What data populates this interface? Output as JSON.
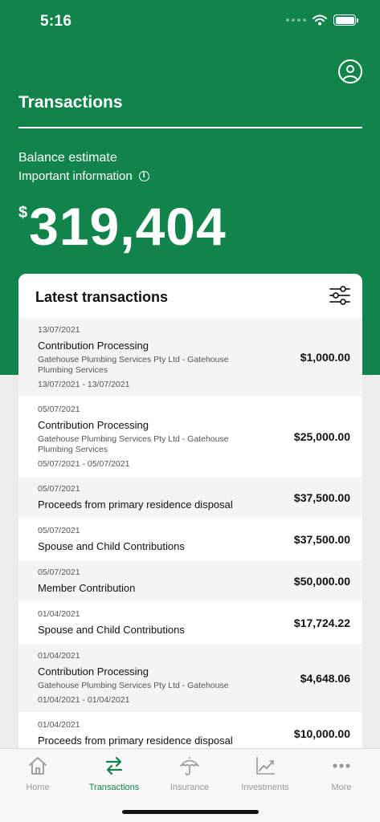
{
  "status_bar": {
    "time": "5:16"
  },
  "header": {
    "title": "Transactions",
    "balance_label": "Balance estimate",
    "info_label": "Important information",
    "currency_symbol": "$",
    "balance_amount": "319,404"
  },
  "card": {
    "title": "Latest transactions"
  },
  "transactions": [
    {
      "date": "13/07/2021",
      "title": "Contribution Processing",
      "description": "Gatehouse Plumbing Services Pty Ltd - Gatehouse Plumbing Services",
      "range": "13/07/2021 - 13/07/2021",
      "amount": "$1,000.00"
    },
    {
      "date": "05/07/2021",
      "title": "Contribution Processing",
      "description": "Gatehouse Plumbing Services Pty Ltd - Gatehouse Plumbing Services",
      "range": "05/07/2021 - 05/07/2021",
      "amount": "$25,000.00"
    },
    {
      "date": "05/07/2021",
      "title": "Proceeds from primary residence disposal",
      "amount": "$37,500.00"
    },
    {
      "date": "05/07/2021",
      "title": "Spouse and Child Contributions",
      "amount": "$37,500.00"
    },
    {
      "date": "05/07/2021",
      "title": "Member Contribution",
      "amount": "$50,000.00"
    },
    {
      "date": "01/04/2021",
      "title": "Spouse and Child Contributions",
      "amount": "$17,724.22"
    },
    {
      "date": "01/04/2021",
      "title": "Contribution Processing",
      "description": "Gatehouse Plumbing Services Pty Ltd - Gatehouse",
      "range": "01/04/2021 - 01/04/2021",
      "amount": "$4,648.06"
    },
    {
      "date": "01/04/2021",
      "title": "Proceeds from primary residence disposal",
      "amount": "$10,000.00"
    }
  ],
  "tabs": [
    {
      "label": "Home",
      "icon": "home-icon",
      "active": false
    },
    {
      "label": "Transactions",
      "icon": "transfer-arrows-icon",
      "active": true
    },
    {
      "label": "Insurance",
      "icon": "umbrella-icon",
      "active": false
    },
    {
      "label": "Investments",
      "icon": "chart-line-icon",
      "active": false
    },
    {
      "label": "More",
      "icon": "more-dots-icon",
      "active": false
    }
  ],
  "colors": {
    "brand_green": "#10844a",
    "page_background": "#ececec",
    "row_alt": "#f4f4f4",
    "tab_inactive": "#999999"
  }
}
